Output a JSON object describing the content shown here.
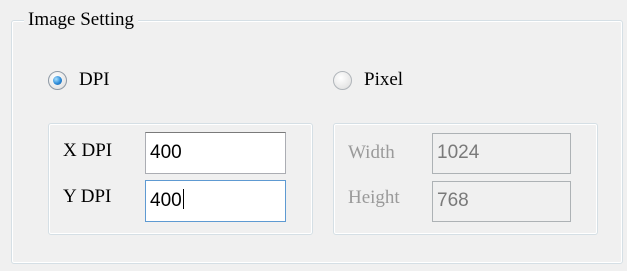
{
  "group": {
    "title": "Image Setting"
  },
  "mode": {
    "dpi_label": "DPI",
    "pixel_label": "Pixel",
    "selected": "DPI"
  },
  "dpi": {
    "x_label": "X DPI",
    "x_value": "400",
    "y_label": "Y DPI",
    "y_value": "400"
  },
  "pixel": {
    "width_label": "Width",
    "width_value": "1024",
    "height_label": "Height",
    "height_value": "768"
  },
  "colors": {
    "radio_selected": "#2b8ad8",
    "focus_border": "#5e9ad2",
    "disabled_text": "#9a9a9a"
  }
}
